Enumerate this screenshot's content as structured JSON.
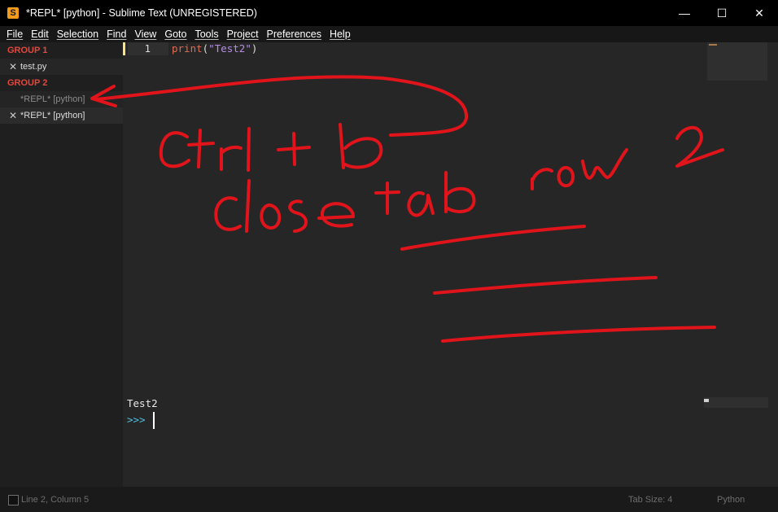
{
  "window": {
    "title": "*REPL* [python] - Sublime Text (UNREGISTERED)",
    "icon_letter": "S",
    "minimize": "—",
    "maximize": "☐",
    "close": "✕"
  },
  "menu": [
    "File",
    "Edit",
    "Selection",
    "Find",
    "View",
    "Goto",
    "Tools",
    "Project",
    "Preferences",
    "Help"
  ],
  "sidebar": {
    "group1_title": "GROUP 1",
    "group1_files": [
      "test.py"
    ],
    "group2_title": "GROUP 2",
    "group2_files": [
      "*REPL* [python]",
      "*REPL* [python]"
    ]
  },
  "editor": {
    "line_number": "1",
    "code_func": "print",
    "code_open": "(",
    "code_str": "\"Test2\"",
    "code_close": ")"
  },
  "repl": {
    "output": "Test2",
    "prompt": ">>>"
  },
  "status": {
    "position": "Line 2, Column 5",
    "tab_size": "Tab Size: 4",
    "syntax": "Python"
  },
  "annotation": {
    "color": "#e0141a"
  },
  "colors": {
    "group_title": "#e0483e",
    "keyword": "#e06c50",
    "string": "#b48ee6",
    "prompt": "#4ec0e0",
    "line_marker": "#ffe27a"
  }
}
